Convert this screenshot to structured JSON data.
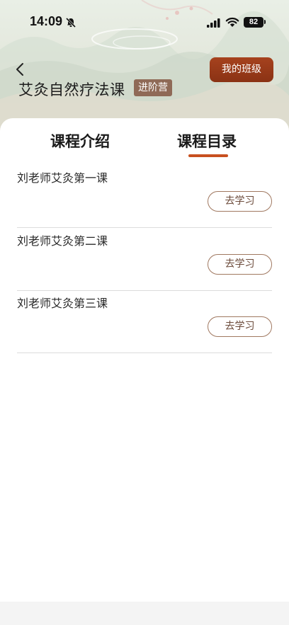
{
  "status_bar": {
    "time": "14:09",
    "battery": "82",
    "icons": [
      "bell-slash-icon",
      "signal-icon",
      "wifi-icon",
      "battery-icon"
    ]
  },
  "header": {
    "title": "艾灸自然疗法课",
    "badge": "进阶营",
    "my_class_button": "我的班级",
    "colors": {
      "button": "#9a3a1a",
      "badge": "#8f6a57"
    }
  },
  "tabs": [
    {
      "label": "课程介绍",
      "active": false
    },
    {
      "label": "课程目录",
      "active": true
    }
  ],
  "accent_color": "#c8501f",
  "lessons": [
    {
      "title": "刘老师艾灸第一课",
      "button": "去学习"
    },
    {
      "title": "刘老师艾灸第二课",
      "button": "去学习"
    },
    {
      "title": "刘老师艾灸第三课",
      "button": "去学习"
    }
  ]
}
